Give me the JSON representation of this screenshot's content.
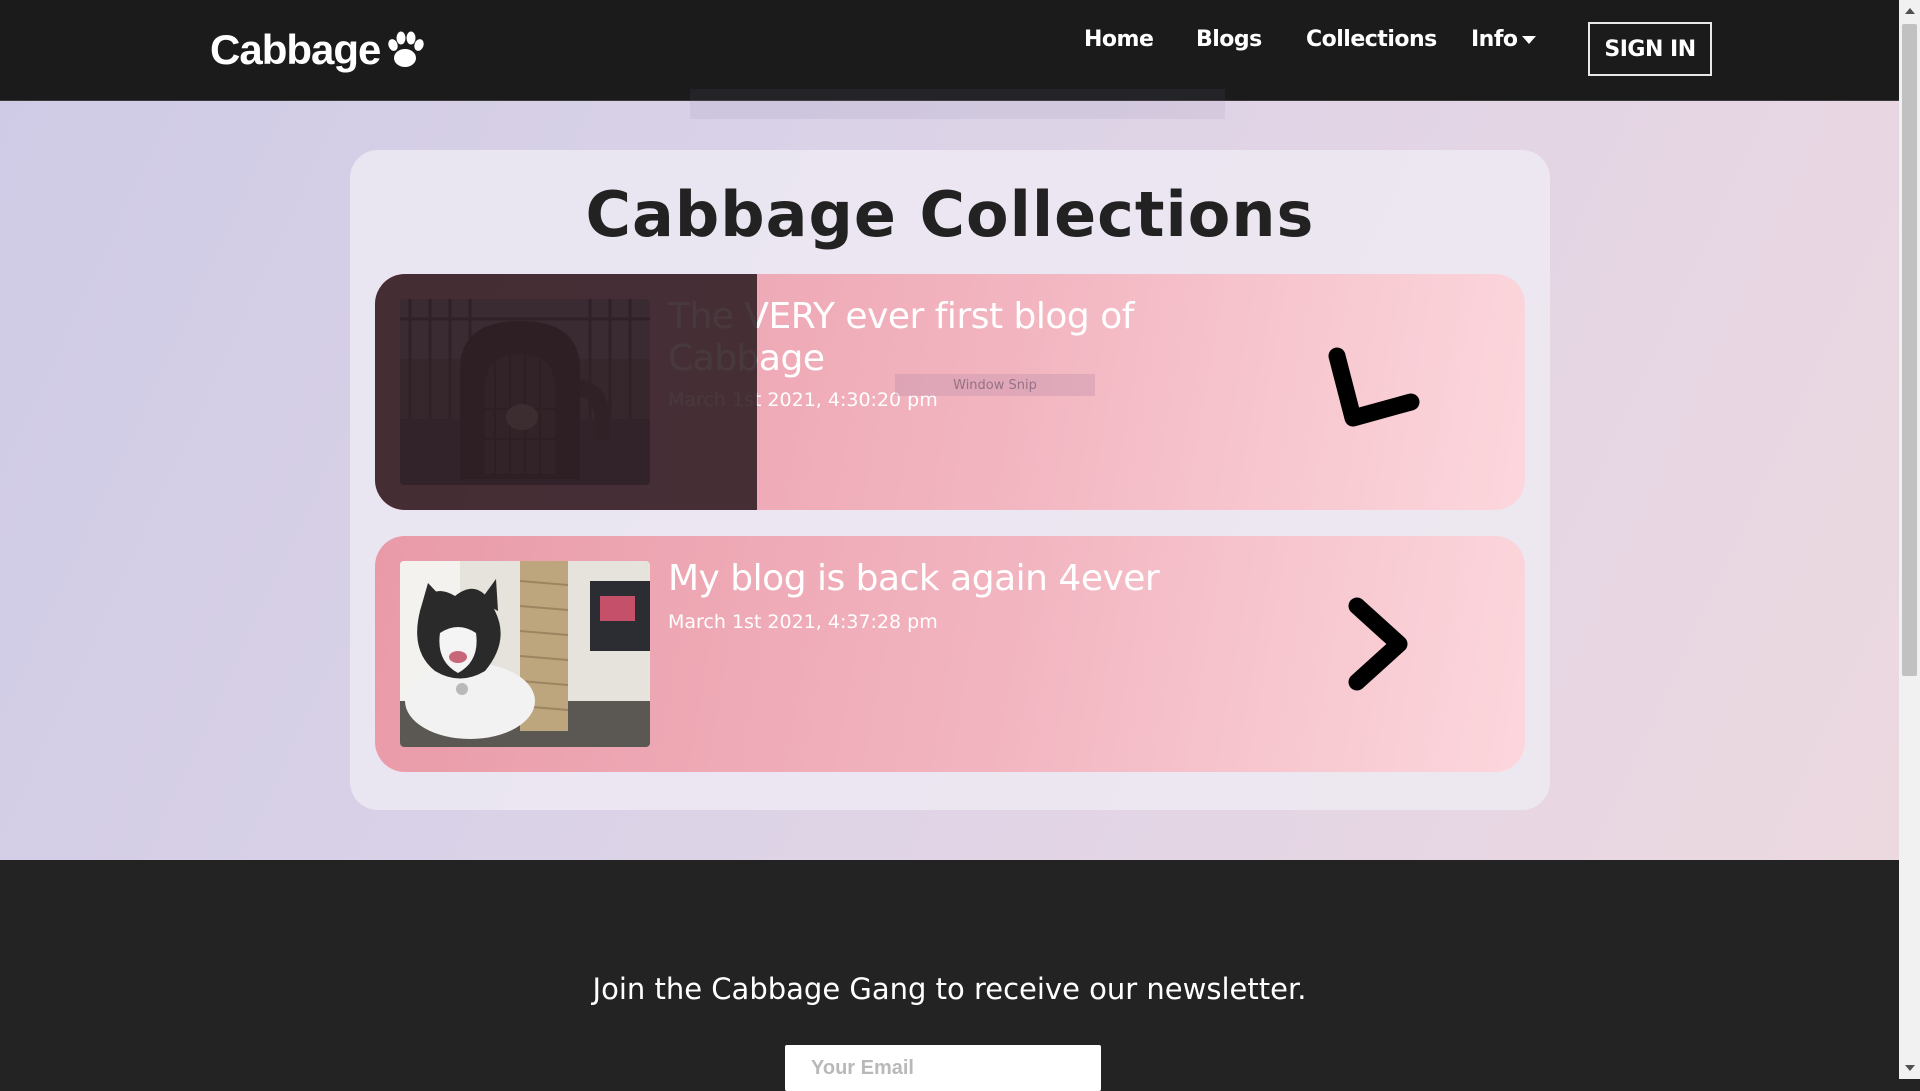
{
  "navbar": {
    "brand": "Cabbage",
    "links": [
      "Home",
      "Blogs",
      "Collections",
      "Info"
    ],
    "sign_in_label": "SIGN IN"
  },
  "main": {
    "title": "Cabbage Collections",
    "cards": [
      {
        "title": "The VERY ever first blog of Cabbage",
        "date": "March 1st 2021, 4:30:20 pm",
        "image": "cat in pet carrier on a porch"
      },
      {
        "title": "My blog is back again 4ever",
        "date": "March 1st 2021, 4:37:28 pm",
        "image": "black and white cat next to scratching post"
      }
    ],
    "snip_label": "Window Snip"
  },
  "footer": {
    "newsletter_text": "Join the Cabbage Gang to receive our newsletter.",
    "email_placeholder": "Your Email"
  },
  "colors": {
    "navbar": "#1b1b1b",
    "card_start": "#e99aa8",
    "card_end": "#fcd7dd",
    "footer": "#232323"
  }
}
